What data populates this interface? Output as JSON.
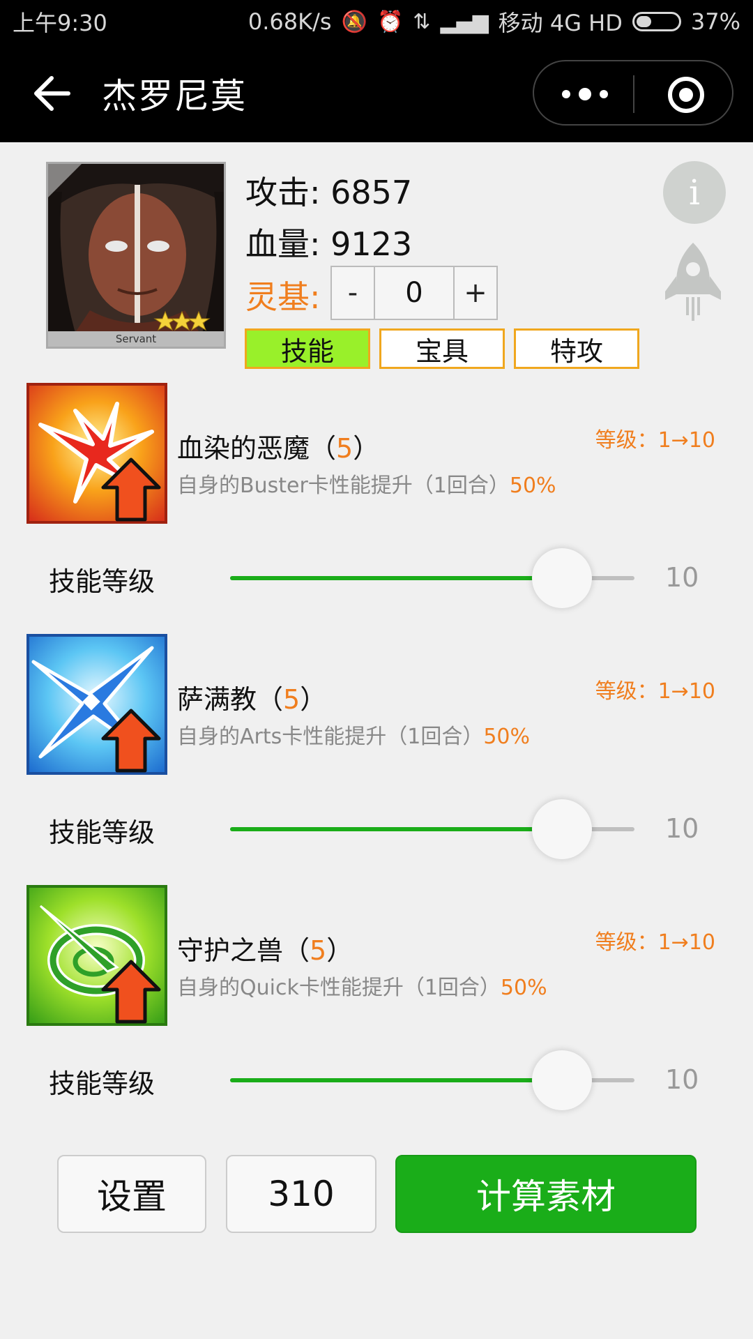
{
  "status_bar": {
    "time": "上午9:30",
    "speed": "0.68K/s",
    "carrier": "移动 4G HD",
    "battery": "37%",
    "battery_level": 0.37
  },
  "header": {
    "title": "杰罗尼莫"
  },
  "profile": {
    "portrait_caption": "Servant",
    "attack_label": "攻击:",
    "attack_value": "6857",
    "hp_label": "血量:",
    "hp_value": "9123",
    "lingji_label": "灵基:",
    "stepper": {
      "minus": "-",
      "value": "0",
      "plus": "+"
    },
    "info_label": "i"
  },
  "tabs": [
    {
      "label": "技能",
      "active": true
    },
    {
      "label": "宝具",
      "active": false
    },
    {
      "label": "特攻",
      "active": false
    }
  ],
  "skills": [
    {
      "name": "血染的恶魔（",
      "num": "5",
      "name_close": "）",
      "desc": "自身的Buster卡性能提升（1回合）",
      "pct": "50%",
      "level_range": "等级：1→10",
      "slider_label": "技能等级",
      "slider_value": "10",
      "slider_fraction": 0.82,
      "icon": "buster-up-icon"
    },
    {
      "name": "萨满教（",
      "num": "5",
      "name_close": "）",
      "desc": "自身的Arts卡性能提升（1回合）",
      "pct": "50%",
      "level_range": "等级：1→10",
      "slider_label": "技能等级",
      "slider_value": "10",
      "slider_fraction": 0.82,
      "icon": "arts-up-icon"
    },
    {
      "name": "守护之兽（",
      "num": "5",
      "name_close": "）",
      "desc": "自身的Quick卡性能提升（1回合）",
      "pct": "50%",
      "level_range": "等级：1→10",
      "slider_label": "技能等级",
      "slider_value": "10",
      "slider_fraction": 0.82,
      "icon": "quick-up-icon"
    }
  ],
  "bottom": {
    "settings_label": "设置",
    "count_value": "310",
    "calc_label": "计算素材"
  },
  "colors": {
    "accent_orange": "#f07e1e",
    "primary_green": "#1aad19",
    "active_tab": "#99f02a",
    "tab_border": "#f0a71e"
  }
}
